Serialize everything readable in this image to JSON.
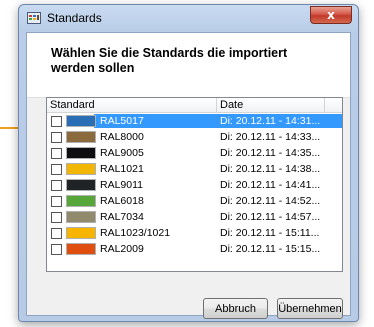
{
  "window": {
    "title": "Standards",
    "close_label": "x"
  },
  "dialog": {
    "heading": "Wählen Sie die Standards die importiert werden sollen"
  },
  "list": {
    "columns": [
      "Standard",
      "Date"
    ],
    "selected_index": 0,
    "rows": [
      {
        "name": "RAL5017",
        "date": "Di: 20.12.11 - 14:31...",
        "color": "#2a6fb5",
        "checked": false
      },
      {
        "name": "RAL8000",
        "date": "Di: 20.12.11 - 14:33...",
        "color": "#8b6a3e",
        "checked": false
      },
      {
        "name": "RAL9005",
        "date": "Di: 20.12.11 - 14:35...",
        "color": "#0e0e10",
        "checked": false
      },
      {
        "name": "RAL1021",
        "date": "Di: 20.12.11 - 14:38...",
        "color": "#f2b705",
        "checked": false
      },
      {
        "name": "RAL9011",
        "date": "Di: 20.12.11 - 14:41...",
        "color": "#1f2326",
        "checked": false
      },
      {
        "name": "RAL6018",
        "date": "Di: 20.12.11 - 14:52...",
        "color": "#57a639",
        "checked": false
      },
      {
        "name": "RAL7034",
        "date": "Di: 20.12.11 - 14:57...",
        "color": "#928a6d",
        "checked": false
      },
      {
        "name": "RAL1023/1021",
        "date": "Di: 20.12.11 - 15:11...",
        "color": "#f7b500",
        "checked": false
      },
      {
        "name": "RAL2009",
        "date": "Di: 20.12.11 - 15:15...",
        "color": "#e04e0f",
        "checked": false
      }
    ]
  },
  "buttons": {
    "cancel": "Abbruch",
    "accept": "Übernehmen"
  },
  "colors": {
    "selection": "#3399ff",
    "callout": "#f0a020"
  }
}
